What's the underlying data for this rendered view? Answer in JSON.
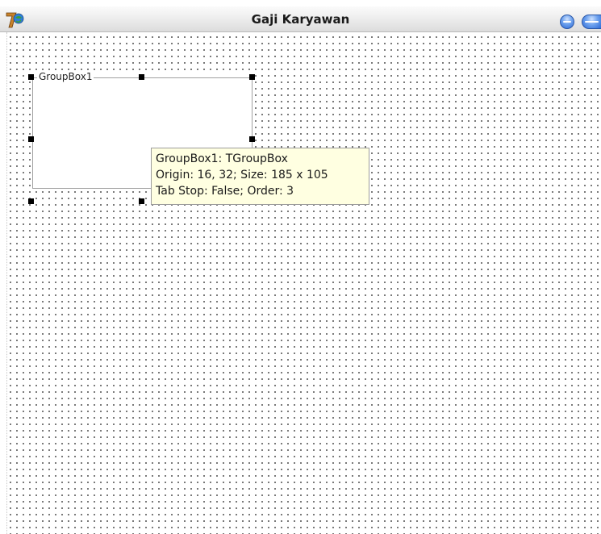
{
  "window": {
    "title": "Gaji Karyawan",
    "icon": "delphi-helmet-icon"
  },
  "groupbox": {
    "caption": "GroupBox1"
  },
  "tooltip": {
    "line1": "GroupBox1: TGroupBox",
    "line2": "Origin: 16, 32; Size: 185 x 105",
    "line3": "Tab Stop: False; Order: 3"
  },
  "colors": {
    "tooltip_background": "#ffffe1",
    "title_buttons": "#2d6ad6",
    "selection_handles": "#000000"
  }
}
